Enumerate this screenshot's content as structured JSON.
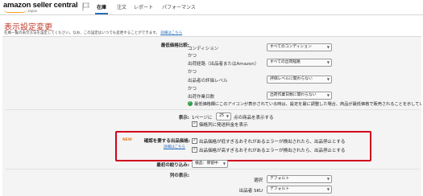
{
  "header": {
    "logo_text": "amazon seller central",
    "logo_sub": "Japan",
    "nav": [
      "在庫",
      "注文",
      "レポート",
      "パフォーマンス"
    ]
  },
  "page": {
    "title": "表示設定変更",
    "description": "在庫一覧の表示方法を設定してください。なお、この設定はいつでも変更することができます。",
    "description_link": "詳細はこちら"
  },
  "lowest_price": {
    "label": "最低価格比較:",
    "condition_label": "コンディション",
    "condition_value": "すべてのコンディション",
    "and1": "かつ",
    "channel_label": "出荷経路（出品者またはAmazon）",
    "channel_value": "すべての出荷経路",
    "and2": "かつ",
    "rating_label": "出品者の評価レベル",
    "rating_value": "評価レベルに関わらない",
    "and3": "かつ",
    "lead_time_label": "出荷作業日数",
    "lead_time_value": "出荷作業日数に関わらない",
    "note": "最低価格欄にこのアイコンが表示されている時は、設定を最に調整した場合、商品が最低価格で販売されることを示しています。"
  },
  "display": {
    "label": "表示:",
    "per_page_prefix": "1ページに",
    "per_page_value": "25",
    "per_page_suffix": "点の商品を表示する",
    "show_cost_label": "価格列に発送料金を表示"
  },
  "confirm": {
    "new_badge": "NEW",
    "label": "確認を要する出品価格:",
    "detail_link": "詳細はこちら",
    "option1": "出品価格が低すぎるおそれがあるエラーが検出されたら、出品停止とする",
    "option2": "出品価格が高すぎるおそれがあるエラーが検出されたら、出品停止とする"
  },
  "default_search": {
    "label": "最初の絞り込み:",
    "value": "検品：保留中"
  },
  "columns": {
    "label": "列の表示:",
    "row1_label": "選択",
    "row1_value": "デフォルト",
    "row2_label": "出品者 SKU",
    "row2_value": "デフォルト"
  },
  "colors": {
    "accent_red": "#d0021b",
    "title_red": "#c0392b",
    "link_blue": "#2a6ebb",
    "success_green": "#2f9e44"
  }
}
